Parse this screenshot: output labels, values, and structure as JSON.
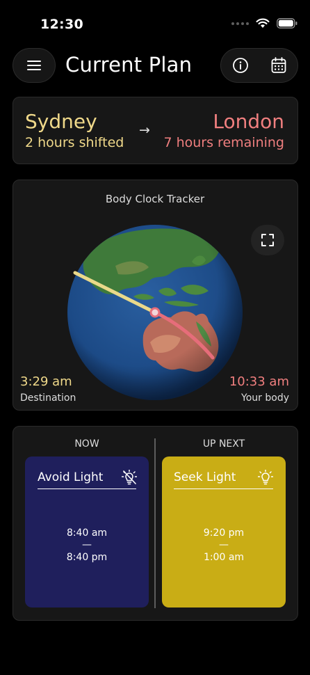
{
  "status_bar": {
    "time": "12:30"
  },
  "header": {
    "title": "Current Plan"
  },
  "route": {
    "origin": "Sydney",
    "origin_status": "2 hours shifted",
    "arrow": "→",
    "destination": "London",
    "destination_status": "7 hours remaining"
  },
  "tracker": {
    "title": "Body Clock Tracker",
    "destination_time": "3:29 am",
    "destination_label": "Destination",
    "body_time": "10:33 am",
    "body_label": "Your body"
  },
  "schedule": {
    "now": {
      "heading": "NOW",
      "title": "Avoid Light",
      "icon": "light-off-icon",
      "start": "8:40 am",
      "separator": "—",
      "end": "8:40 pm",
      "color": "#1f1f5c"
    },
    "next": {
      "heading": "UP NEXT",
      "title": "Seek Light",
      "icon": "lightbulb-icon",
      "start": "9:20 pm",
      "separator": "—",
      "end": "1:00 am",
      "color": "#c9ad15"
    }
  },
  "colors": {
    "origin": "#f0d98a",
    "destination": "#f07f7f"
  }
}
